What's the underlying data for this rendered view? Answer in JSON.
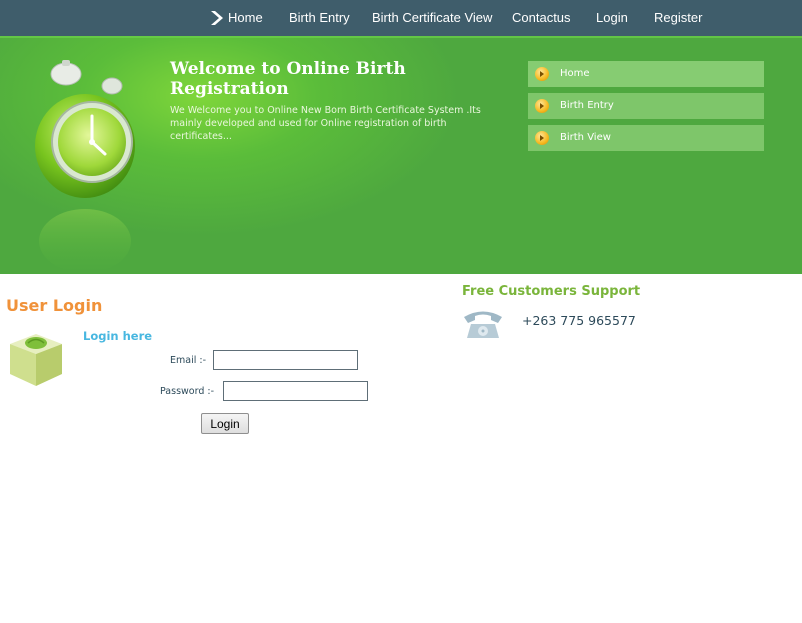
{
  "nav": {
    "items": [
      {
        "label": "Home"
      },
      {
        "label": "Birth Entry"
      },
      {
        "label": "Birth Certificate View"
      },
      {
        "label": "Contactus"
      },
      {
        "label": "Login"
      },
      {
        "label": "Register"
      }
    ],
    "active_icon": "chevron-right-icon"
  },
  "banner": {
    "title": "Welcome to Online Birth Registration",
    "text": "We Welcome you to Online New Born Birth Certificate System .Its mainly developed and used for Online registration of birth certificates...",
    "side_menu": [
      {
        "label": "Home"
      },
      {
        "label": "Birth Entry"
      },
      {
        "label": "Birth View"
      }
    ]
  },
  "login": {
    "title": "User Login",
    "subtitle": "Login here",
    "email_label": "Email :-",
    "email_value": "",
    "password_label": "Password :-",
    "password_value": "",
    "button_label": "Login"
  },
  "support": {
    "title": "Free Customers Support",
    "phone": "+263 775 965577"
  },
  "colors": {
    "nav_bg": "#3f5d6b",
    "banner_green": "#4ea83f",
    "login_title": "#f0923a",
    "login_here": "#48b7e0",
    "support_title": "#7ab53b"
  }
}
